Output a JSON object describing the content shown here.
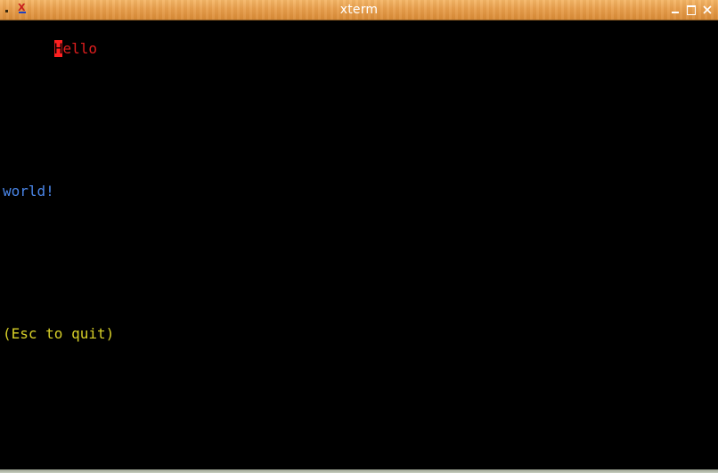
{
  "window": {
    "title": "xterm"
  },
  "terminal": {
    "lines": {
      "hello_cursor_char": "H",
      "hello_rest": "ello",
      "world": "world!",
      "quit_hint": "(Esc to quit)"
    }
  },
  "colors": {
    "titlebar": "#e9a04e",
    "background": "#000000",
    "hello": "#e01e1e",
    "world": "#4a86e8",
    "quit_hint": "#d8d028",
    "cursor": "#ff2020"
  },
  "icons": {
    "window_menu": "window-menu-icon",
    "app": "xterm-app-icon",
    "minimize": "minimize-icon",
    "maximize": "maximize-icon",
    "close": "close-icon"
  }
}
